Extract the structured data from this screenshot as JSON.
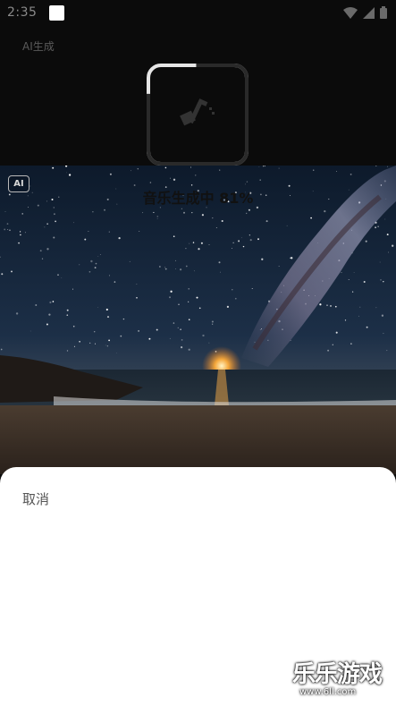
{
  "status_bar": {
    "time": "2:35",
    "icons": [
      "notification-square-icon",
      "wifi-icon",
      "signal-icon",
      "battery-icon"
    ]
  },
  "header": {
    "title": "AI生成"
  },
  "image": {
    "ai_badge": "AI"
  },
  "sheet": {
    "cancel_label": "取消",
    "progress_text": "音乐生成中 81%",
    "progress_fraction": 0.81
  },
  "watermark": {
    "brand": "乐乐游戏",
    "url": "www.6ll.com"
  },
  "colors": {
    "sheet_bg": "#ffffff",
    "progress_track": "#e6e6e6",
    "progress_fill": "#2a2a2a"
  }
}
